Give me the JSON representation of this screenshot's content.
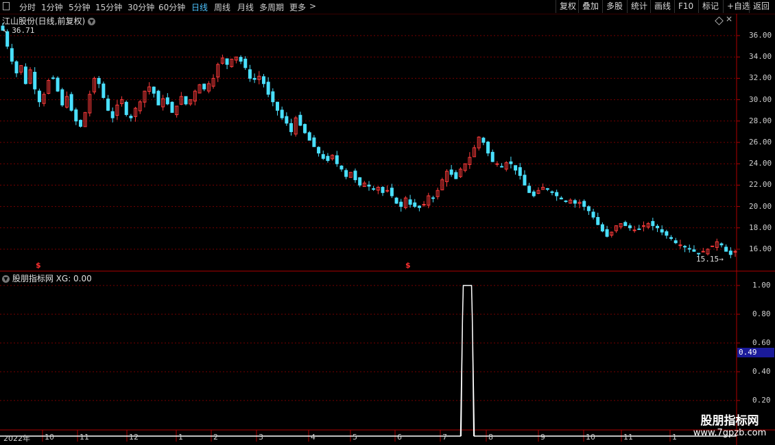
{
  "toolbar": {
    "left_items": [
      "分时",
      "1分钟",
      "5分钟",
      "15分钟",
      "30分钟",
      "60分钟",
      "日线",
      "周线",
      "月线",
      "多周期",
      "更多"
    ],
    "active_item": "日线",
    "right_buttons": [
      "复权",
      "叠加",
      "多股",
      "统计",
      "画线",
      "F10",
      "标记",
      "+自选",
      "返回"
    ]
  },
  "main_panel": {
    "title": "江山股份(日线,前复权)",
    "high_label": "36.71",
    "low_label": "15.15",
    "y_ticks": [
      "36.00",
      "34.00",
      "32.00",
      "30.00",
      "28.00",
      "26.00",
      "24.00",
      "22.00",
      "20.00",
      "18.00",
      "16.00"
    ],
    "marker_glyph": "$"
  },
  "indicator_panel": {
    "title": "股朋指标网",
    "value_text": "XG: 0.00",
    "y_ticks": [
      "1.00",
      "0.80",
      "0.60",
      "0.40",
      "0.20"
    ],
    "current_value": "0.49"
  },
  "x_axis": {
    "labels": [
      "2022年",
      "10",
      "11",
      "12",
      "1",
      "2",
      "3",
      "4",
      "5",
      "6",
      "7",
      "8",
      "9",
      "10",
      "11",
      "1"
    ]
  },
  "watermark": {
    "line1": "股朋指标网",
    "line2": "www.7gpzb.com"
  },
  "colors": {
    "up": "#ff3b3b",
    "down": "#4ae0ff",
    "grid": "#7a0000",
    "axis": "#b00000",
    "signal": "#ffffff"
  },
  "chart_data": [
    {
      "type": "candlestick",
      "title": "江山股份(日线,前复权)",
      "ylim": [
        15.0,
        37.0
      ],
      "x_start": "2022-09",
      "x_end": "2024-01",
      "max_price": 36.71,
      "min_price": 15.15,
      "close_path": [
        36.5,
        35.0,
        33.6,
        32.5,
        33.2,
        31.5,
        32.8,
        31.0,
        29.8,
        30.5,
        31.8,
        32.0,
        30.8,
        29.5,
        30.3,
        29.0,
        28.0,
        27.5,
        28.8,
        30.5,
        32.0,
        31.5,
        30.2,
        29.0,
        28.3,
        29.5,
        30.0,
        28.6,
        28.3,
        29.2,
        29.8,
        30.8,
        31.2,
        30.6,
        29.5,
        30.1,
        29.6,
        28.8,
        29.4,
        30.3,
        29.6,
        30.0,
        30.8,
        31.4,
        31.0,
        31.5,
        32.0,
        33.3,
        33.9,
        33.3,
        33.8,
        34.0,
        33.6,
        33.0,
        32.0,
        31.9,
        32.2,
        31.5,
        30.5,
        29.8,
        29.0,
        28.3,
        27.8,
        27.0,
        28.3,
        27.6,
        26.9,
        26.2,
        25.6,
        25.0,
        24.5,
        24.3,
        24.8,
        24.0,
        23.5,
        22.8,
        23.2,
        22.5,
        22.0,
        22.2,
        21.9,
        21.6,
        21.8,
        21.3,
        21.5,
        21.0,
        20.3,
        20.0,
        20.8,
        20.2,
        20.0,
        19.9,
        20.2,
        21.0,
        20.8,
        21.5,
        22.5,
        23.3,
        23.0,
        22.6,
        23.5,
        24.0,
        24.6,
        25.5,
        26.5,
        26.0,
        25.0,
        24.2,
        24.0,
        23.7,
        24.1,
        24.0,
        23.4,
        22.9,
        22.0,
        21.3,
        21.0,
        21.5,
        21.8,
        21.6,
        21.3,
        21.0,
        20.7,
        20.5,
        20.6,
        20.3,
        20.4,
        20.0,
        19.6,
        19.0,
        18.3,
        17.7,
        17.2,
        17.6,
        18.2,
        18.4,
        18.2,
        18.0,
        17.8,
        17.9,
        18.2,
        18.4,
        18.2,
        18.0,
        17.6,
        17.3,
        17.0,
        16.6,
        16.4,
        16.2,
        16.0,
        15.8,
        15.6,
        15.8,
        16.0,
        16.3,
        16.7,
        16.4,
        15.8,
        15.5,
        15.8
      ]
    },
    {
      "type": "line",
      "title": "股朋指标网",
      "ylim": [
        0,
        1.05
      ],
      "signal": "XG",
      "current": 0.0,
      "pulse": {
        "start_index": 100,
        "end_index": 103,
        "value": 1.0
      }
    }
  ]
}
